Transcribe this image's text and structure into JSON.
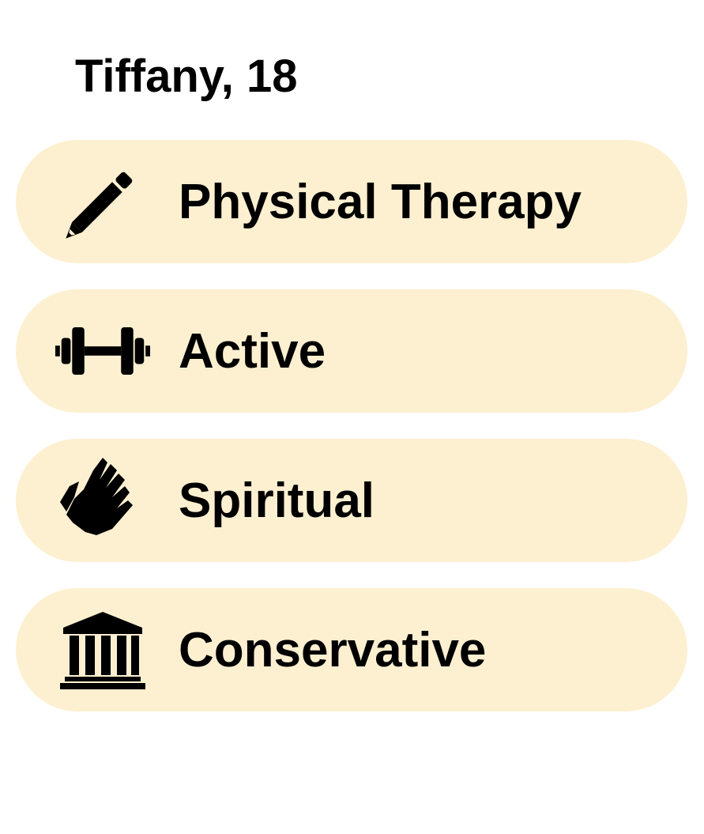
{
  "profile": {
    "name_age": "Tiffany, 18"
  },
  "traits": [
    {
      "label": "Physical Therapy",
      "icon": "pencil-icon"
    },
    {
      "label": "Active",
      "icon": "dumbbell-icon"
    },
    {
      "label": "Spiritual",
      "icon": "praying-hands-icon"
    },
    {
      "label": "Conservative",
      "icon": "bank-building-icon"
    }
  ],
  "colors": {
    "pill_background": "#fdf0d0",
    "text": "#000000",
    "icon": "#000000"
  }
}
